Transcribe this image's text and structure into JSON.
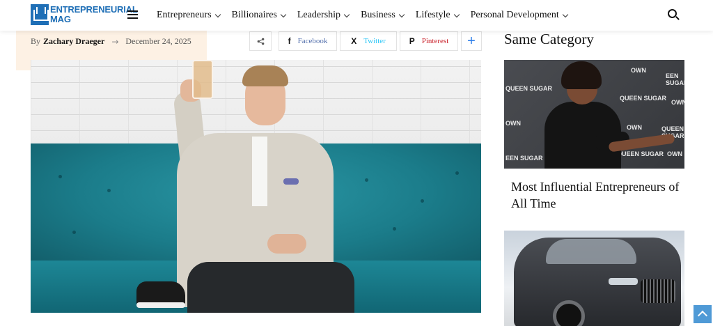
{
  "header": {
    "logo": {
      "line1": "ENTREPRENEURIAL",
      "line2": "MAG"
    },
    "nav": [
      {
        "label": "Entrepreneurs"
      },
      {
        "label": "Billionaires"
      },
      {
        "label": "Leadership"
      },
      {
        "label": "Business"
      },
      {
        "label": "Lifestyle"
      },
      {
        "label": "Personal Development"
      }
    ]
  },
  "article": {
    "by_prefix": "By",
    "author": "Zachary Draeger",
    "arrow": "→",
    "date": "December 24, 2025"
  },
  "share": {
    "toggle_icon": "share-icon",
    "facebook": {
      "icon": "f",
      "label": "Facebook"
    },
    "twitter": {
      "icon": "X",
      "label": "Twitter"
    },
    "pinterest": {
      "icon": "P",
      "label": "Pinterest"
    },
    "more": "+"
  },
  "sidebar": {
    "title": "Same Category",
    "items": [
      {
        "headline": "Most Influential Entrepreneurs of All Time",
        "image_texts": [
          "OWN",
          "QUEEN SUGAR",
          "OWN",
          "EEN SUGAR",
          "QUEEN SUGAR",
          "OWN",
          "OWN",
          "QUEEN SUGAR",
          "OWN",
          "QUEEN SUGAR",
          "EEN SUGAR"
        ]
      },
      {
        "headline": ""
      }
    ]
  },
  "colors": {
    "brand": "#1f6fb6",
    "facebook": "#516eab",
    "twitter": "#29c5f6",
    "pinterest": "#ca212a",
    "accent_plus": "#2b7de9",
    "meta_band": "#fdf1e4",
    "scroll_top": "#4f9ad6"
  }
}
